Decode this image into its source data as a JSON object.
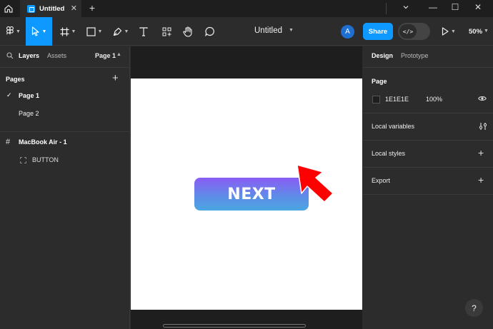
{
  "titlebar": {
    "tab_label": "Untitled",
    "tab_close": "✕",
    "new_tab": "+",
    "minimize": "—",
    "maximize": "☐",
    "close": "✕"
  },
  "toolbar": {
    "tools": [
      "main-menu",
      "move",
      "frame",
      "shape",
      "pen",
      "text",
      "resources",
      "hand",
      "comment"
    ],
    "active_tool": "move",
    "document_title": "Untitled",
    "avatar_initial": "A",
    "share_label": "Share",
    "devmode_label": "</>",
    "zoom": "50%"
  },
  "left_panel": {
    "tab_layers": "Layers",
    "tab_assets": "Assets",
    "page_selector": "Page 1",
    "pages_heading": "Pages",
    "pages": [
      {
        "label": "Page 1",
        "current": true
      },
      {
        "label": "Page 2",
        "current": false
      }
    ],
    "layers": {
      "frame": "MacBook Air - 1",
      "children": [
        "BUTTON"
      ]
    }
  },
  "canvas": {
    "button_text": "NEXT",
    "artboard_color": "#FFFFFF",
    "button_gradient": [
      "#8a5cf5",
      "#4ba6e2"
    ],
    "arrow_color": "#ff0000"
  },
  "right_panel": {
    "tab_design": "Design",
    "tab_prototype": "Prototype",
    "page_section": "Page",
    "page_color_hex": "1E1E1E",
    "page_opacity": "100%",
    "local_variables": "Local variables",
    "local_styles": "Local styles",
    "export": "Export",
    "help": "?"
  },
  "colors": {
    "accent": "#0d99ff",
    "panel": "#2c2c2c",
    "canvas": "#1e1e1e"
  }
}
